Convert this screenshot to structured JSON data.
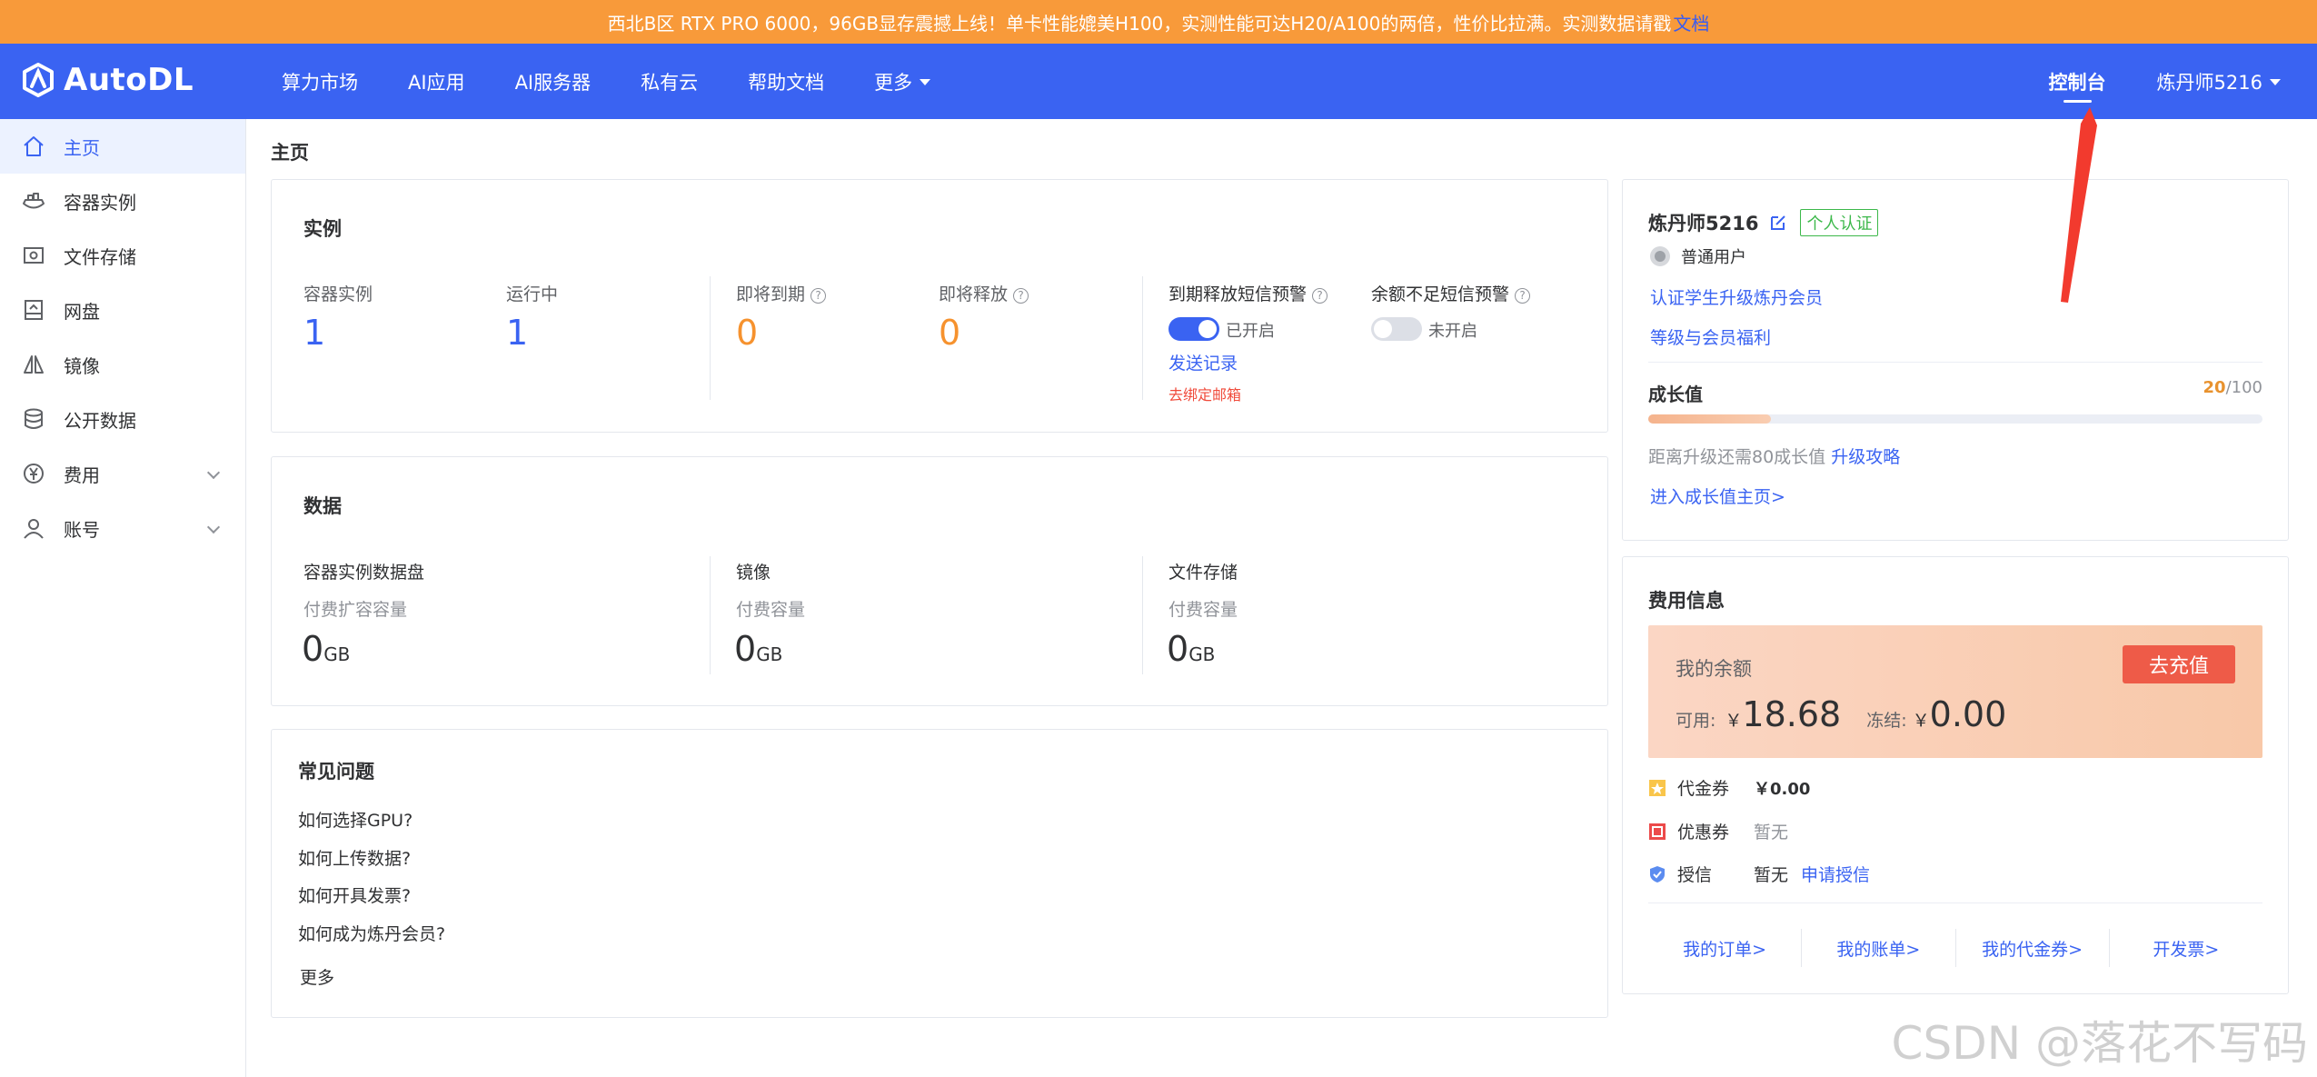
{
  "announcement": {
    "text": "西北B区 RTX PRO 6000，96GB显存震撼上线！单卡性能媲美H100，实测性能可达H20/A100的两倍，性价比拉满。实测数据请戳",
    "link": "文档"
  },
  "nav": {
    "logo": "AutoDL",
    "items": [
      "算力市场",
      "AI应用",
      "AI服务器",
      "私有云",
      "帮助文档",
      "更多"
    ],
    "console": "控制台",
    "user": "炼丹师5216"
  },
  "sidebar": {
    "items": [
      {
        "label": "主页",
        "icon": "home-icon"
      },
      {
        "label": "容器实例",
        "icon": "container-icon"
      },
      {
        "label": "文件存储",
        "icon": "file-storage-icon"
      },
      {
        "label": "网盘",
        "icon": "cloud-disk-icon"
      },
      {
        "label": "镜像",
        "icon": "mirror-icon"
      },
      {
        "label": "公开数据",
        "icon": "database-icon"
      },
      {
        "label": "费用",
        "icon": "yen-icon"
      },
      {
        "label": "账号",
        "icon": "user-icon"
      }
    ]
  },
  "main": {
    "page_title": "主页",
    "instances": {
      "title": "实例",
      "container_label": "容器实例",
      "container_value": "1",
      "running_label": "运行中",
      "running_value": "1",
      "expiring_label": "即将到期",
      "expiring_value": "0",
      "releasing_label": "即将释放",
      "releasing_value": "0",
      "sms_expire_label": "到期释放短信预警",
      "sms_expire_state": "已开启",
      "sms_expire_on": true,
      "send_records": "发送记录",
      "bind_email": "去绑定邮箱",
      "sms_balance_label": "余额不足短信预警",
      "sms_balance_state": "未开启",
      "sms_balance_on": false
    },
    "data": {
      "title": "数据",
      "columns": [
        {
          "label": "容器实例数据盘",
          "sub": "付费扩容容量",
          "value": "0",
          "unit": "GB"
        },
        {
          "label": "镜像",
          "sub": "付费容量",
          "value": "0",
          "unit": "GB"
        },
        {
          "label": "文件存储",
          "sub": "付费容量",
          "value": "0",
          "unit": "GB"
        }
      ]
    },
    "faq": {
      "title": "常见问题",
      "items": [
        "如何选择GPU?",
        "如何上传数据?",
        "如何开具发票?",
        "如何成为炼丹会员?"
      ],
      "more": "更多"
    }
  },
  "profile": {
    "name": "炼丹师5216",
    "verify_badge": "个人认证",
    "level": "普通用户",
    "student_link": "认证学生升级炼丹会员",
    "benefits_link": "等级与会员福利",
    "growth_label": "成长值",
    "growth_value": "20",
    "growth_max": "/100",
    "growth_fraction": 0.2,
    "upgrade_text": "距离升级还需80成长值",
    "upgrade_link": "升级攻略",
    "growth_home": "进入成长值主页>"
  },
  "billing": {
    "title": "费用信息",
    "balance_label": "我的余额",
    "recharge": "去充值",
    "available_label": "可用:",
    "available_value": "18.68",
    "frozen_label": "冻结:",
    "frozen_value": "0.00",
    "currency": "￥",
    "voucher_label": "代金券",
    "voucher_value": "￥0.00",
    "coupon_label": "优惠券",
    "coupon_value": "暂无",
    "credit_label": "授信",
    "credit_value": "暂无",
    "credit_link": "申请授信",
    "links": [
      "我的订单>",
      "我的账单>",
      "我的代金券>",
      "开发票>"
    ]
  },
  "watermark": "CSDN @落花不写码",
  "colors": {
    "primary": "#3a63f2",
    "announce": "#f89a3a",
    "orange": "#f6922e",
    "danger": "#ee5b48"
  }
}
